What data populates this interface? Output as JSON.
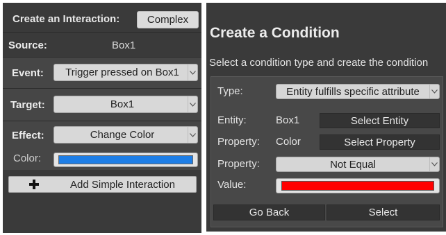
{
  "left": {
    "header_title": "Create an Interaction:",
    "complex_button": "Complex",
    "source_label": "Source:",
    "source_value": "Box1",
    "event_label": "Event:",
    "event_value": "Trigger pressed on Box1",
    "target_label": "Target:",
    "target_value": "Box1",
    "effect_label": "Effect:",
    "effect_value": "Change Color",
    "color_label": "Color:",
    "color_value": "#1e7ee6",
    "add_button": "Add Simple Interaction",
    "icons": {
      "dropdown": "chevron-down-icon",
      "add": "plus-icon"
    }
  },
  "right": {
    "title": "Create a Condition",
    "subtitle": "Select a condition type and create the condition",
    "type_label": "Type:",
    "type_value": "Entity fulfills specific attribute",
    "entity_label": "Entity:",
    "entity_value": "Box1",
    "select_entity_button": "Select Entity",
    "property_label": "Property:",
    "property_value": "Color",
    "select_property_button": "Select Property",
    "property_compare_label": "Property:",
    "property_compare_value": "Not Equal",
    "value_label": "Value:",
    "value_color": "#ff0000",
    "go_back_button": "Go Back",
    "select_button": "Select"
  }
}
